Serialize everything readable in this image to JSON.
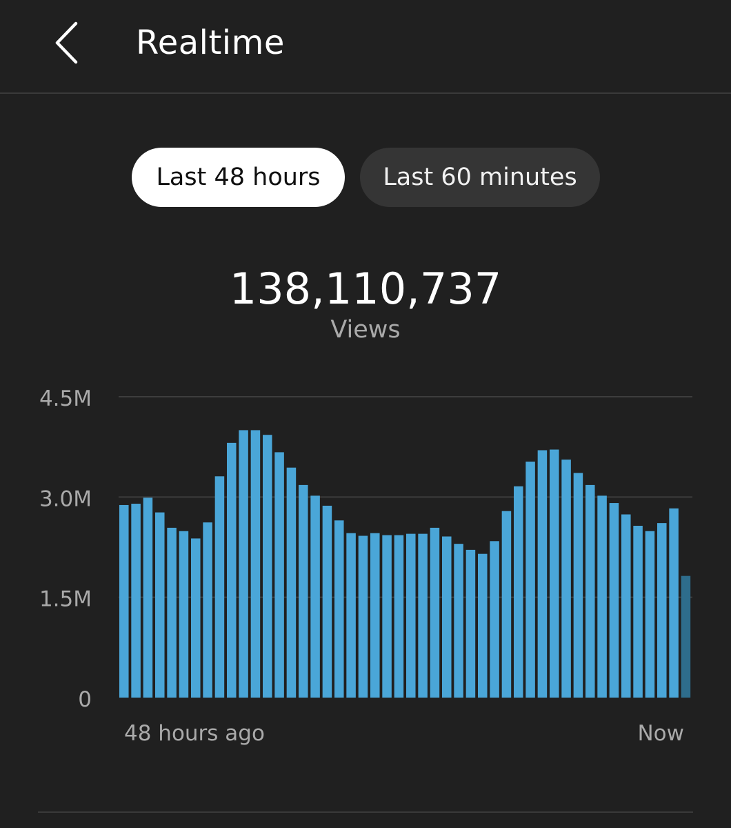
{
  "header": {
    "title": "Realtime",
    "back_icon": "chevron-left-icon"
  },
  "tabs": [
    {
      "label": "Last 48 hours",
      "selected": true
    },
    {
      "label": "Last 60 minutes",
      "selected": false
    }
  ],
  "summary": {
    "total": "138,110,737",
    "metric": "Views"
  },
  "colors": {
    "bar": "#4aa6d8",
    "bar_current": "#2e6d8c",
    "grid": "#3d3d3d",
    "axis_text": "#aaaaaa"
  },
  "chart_data": {
    "type": "bar",
    "y_ticks": [
      "4.5M",
      "3.0M",
      "1.5M",
      "0"
    ],
    "y_tick_values": [
      4500000,
      3000000,
      1500000,
      0
    ],
    "ylim": [
      0,
      4500000
    ],
    "x_labels": {
      "start": "48 hours ago",
      "end": "Now"
    },
    "grid": true,
    "series": [
      {
        "values": [
          2880000,
          2900000,
          2990000,
          2770000,
          2540000,
          2490000,
          2380000,
          2620000,
          3310000,
          3810000,
          4000000,
          4000000,
          3930000,
          3670000,
          3440000,
          3180000,
          3020000,
          2870000,
          2650000,
          2460000,
          2420000,
          2460000,
          2430000,
          2430000,
          2450000,
          2450000,
          2540000,
          2410000,
          2300000,
          2210000,
          2150000,
          2340000,
          2790000,
          3160000,
          3530000,
          3700000,
          3710000,
          3560000,
          3360000,
          3180000,
          3020000,
          2910000,
          2740000,
          2570000,
          2490000,
          2610000,
          2830000,
          1820000
        ]
      }
    ],
    "current_hour_index": 47
  }
}
